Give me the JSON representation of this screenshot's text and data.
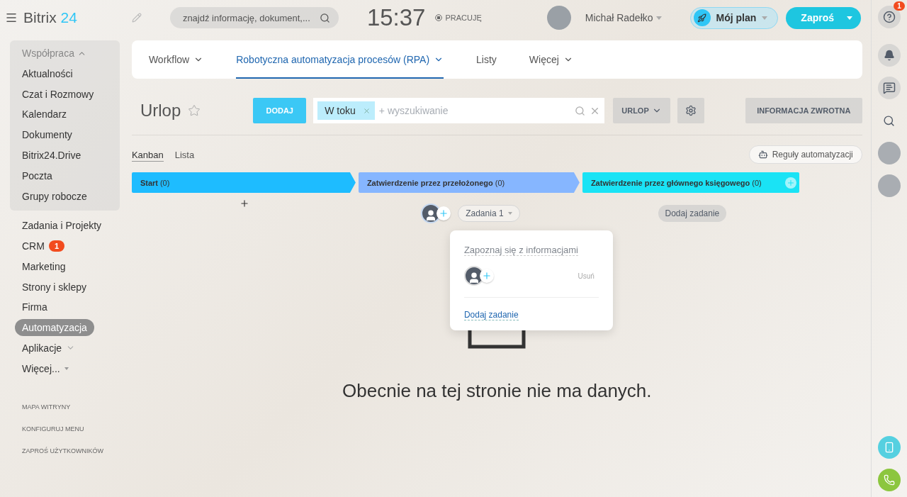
{
  "header": {
    "logo": {
      "name": "Bitrix",
      "accent": "24"
    },
    "search": {
      "placeholder": "znajdź informację, dokument,..."
    },
    "time": "15:37",
    "status": "PRACUJĘ",
    "user": "Michał Radełko",
    "plan_button": "Mój plan",
    "invite_button": "Zaproś"
  },
  "sidebar": {
    "section": {
      "title": "Współpraca",
      "expanded": true,
      "items": [
        {
          "label": "Aktualności",
          "selected": false
        },
        {
          "label": "Czat i Rozmowy",
          "selected": false
        },
        {
          "label": "Kalendarz",
          "selected": false
        },
        {
          "label": "Dokumenty",
          "selected": false
        },
        {
          "label": "Bitrix24.Drive",
          "selected": false
        },
        {
          "label": "Poczta",
          "selected": false
        },
        {
          "label": "Grupy robocze",
          "selected": false
        }
      ]
    },
    "items": [
      {
        "label": "Zadania i Projekty",
        "selected": false
      },
      {
        "label": "CRM",
        "selected": false,
        "badge": "1"
      },
      {
        "label": "Marketing",
        "selected": false
      },
      {
        "label": "Strony i sklepy",
        "selected": false
      },
      {
        "label": "Firma",
        "selected": false
      },
      {
        "label": "Automatyzacja",
        "selected": true
      },
      {
        "label": "Aplikacje",
        "selected": false,
        "kind": "chevron"
      },
      {
        "label": "Więcej...",
        "selected": false,
        "kind": "caret"
      }
    ],
    "footer_links": [
      "MAPA WITRYNY",
      "KONFIGURUJ MENU",
      "ZAPROŚ UŻYTKOWNIKÓW"
    ]
  },
  "tabs": [
    {
      "label": "Workflow",
      "selected": false,
      "dropdown": true
    },
    {
      "label": "Robotyczna automatyzacja procesów (RPA)",
      "selected": true,
      "dropdown": true
    },
    {
      "label": "Listy",
      "selected": false,
      "dropdown": false
    },
    {
      "label": "Więcej",
      "selected": false,
      "dropdown": true
    }
  ],
  "toolbar": {
    "title": "Urlop",
    "add_button": "DODAJ",
    "filter_tag": "W toku",
    "search_placeholder": "+ wyszukiwanie",
    "preset_button": "URLOP",
    "feedback_button": "INFORMACJA ZWROTNA"
  },
  "views": [
    {
      "label": "Kanban",
      "selected": true
    },
    {
      "label": "Lista",
      "selected": false
    }
  ],
  "rules_button": "Reguły automatyzacji",
  "stages": [
    {
      "label": "Start",
      "count": "(0)",
      "color": "#1ebcff"
    },
    {
      "label": "Zatwierdzenie przez przełożonego",
      "count": "(0)",
      "color": "#86b6ff"
    },
    {
      "label": "Zatwierdzenie przez głównego księgowego",
      "count": "(0)",
      "color": "#1ae3f5"
    }
  ],
  "tasks_pill": {
    "label": "Zadania",
    "count": "1"
  },
  "add_task_button": "Dodaj zadanie",
  "popup": {
    "title": "Zapoznaj się z informacjami",
    "remove": "Usuń",
    "link": "Dodaj zadanie"
  },
  "empty_message": "Obecnie na tej stronie nie ma danych.",
  "right_bar": {
    "help_badge": "1"
  }
}
